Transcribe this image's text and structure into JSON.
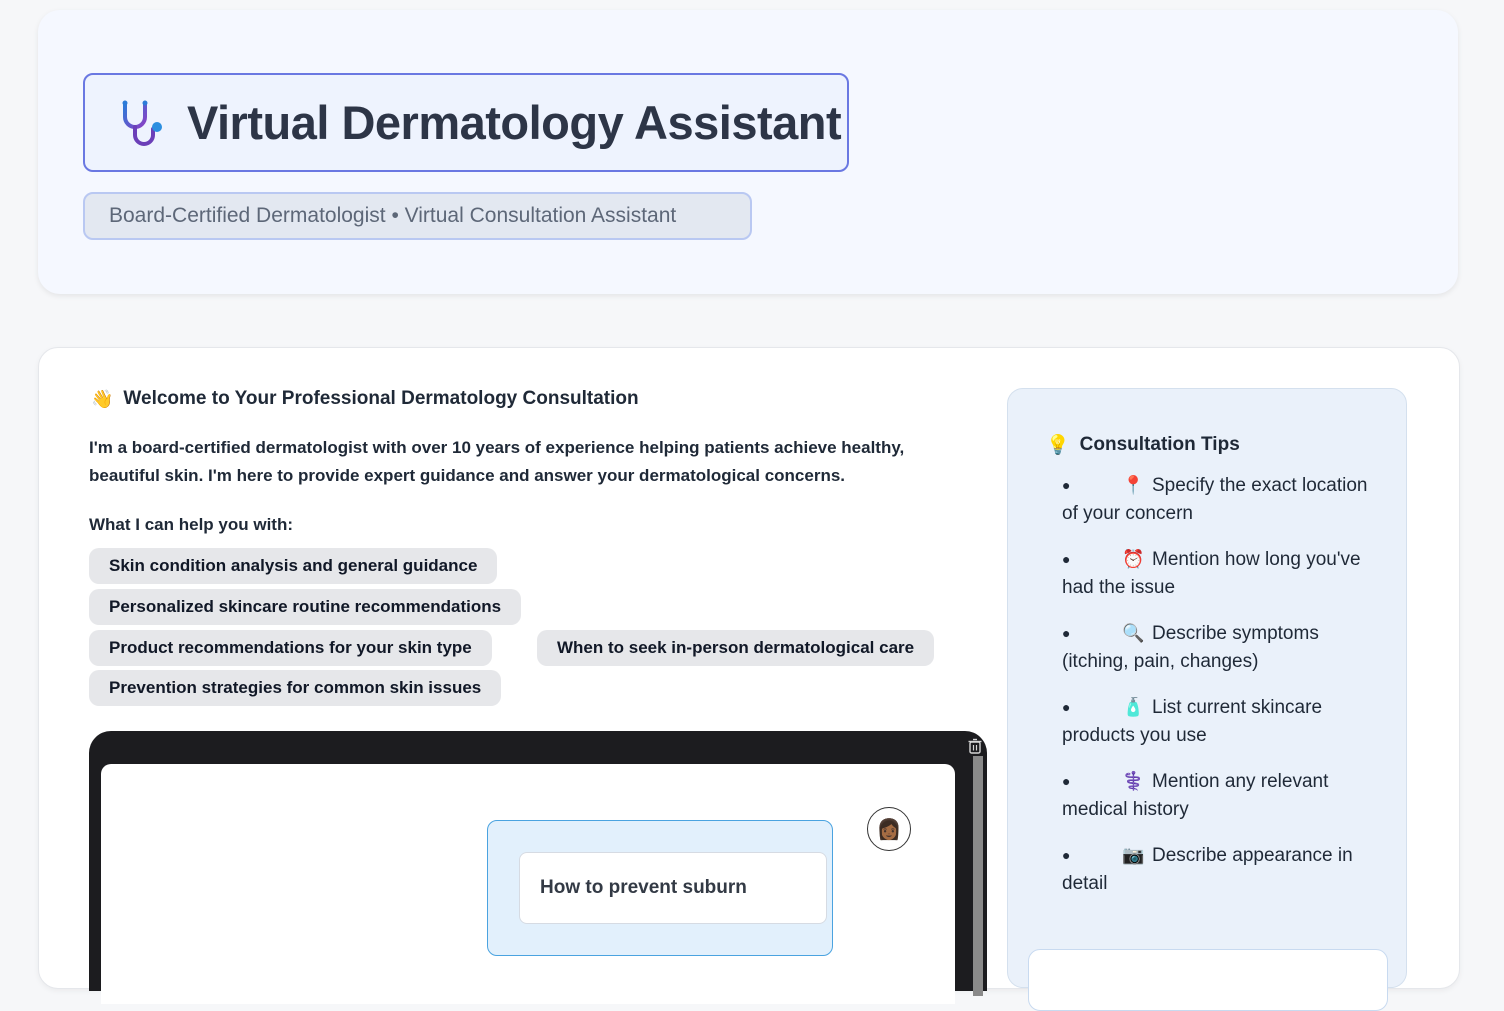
{
  "header": {
    "title": "Virtual Dermatology Assistant",
    "subtitle": "Board-Certified Dermatologist • Virtual Consultation Assistant",
    "icon": "stethoscope-icon"
  },
  "welcome": {
    "emoji": "👋",
    "title": "Welcome to Your Professional Dermatology Consultation",
    "intro": "I'm a board-certified dermatologist with over 10 years of experience helping patients achieve healthy, beautiful skin. I'm here to provide expert guidance and answer your dermatological concerns.",
    "help_label": "What I can help you with:",
    "services": [
      "Skin condition analysis and general guidance",
      "Personalized skincare routine recommendations",
      "Product recommendations for your skin type",
      "When to seek in-person dermatological care",
      "Prevention strategies for common skin issues"
    ]
  },
  "chat": {
    "messages": [
      {
        "role": "user",
        "text": "How to prevent suburn",
        "avatar": "👩🏾"
      }
    ],
    "clear_icon": "trash-icon"
  },
  "tips": {
    "emoji": "💡",
    "title": "Consultation Tips",
    "items": [
      {
        "icon": "📍",
        "text": "Specify the exact location of your concern"
      },
      {
        "icon": "⏰",
        "text": "Mention how long you've had the issue"
      },
      {
        "icon": "🔍",
        "text": "Describe symptoms (itching, pain, changes)"
      },
      {
        "icon": "🧴",
        "text": "List current skincare products you use"
      },
      {
        "icon": "⚕️",
        "text": "Mention any relevant medical history"
      },
      {
        "icon": "📷",
        "text": "Describe appearance in detail"
      }
    ]
  },
  "colors": {
    "title_border": "#6a78e2",
    "subtitle_border": "#b9c8f2",
    "chat_frame": "#1c1c1f",
    "message_bubble": "#e2f0fc",
    "message_border": "#4aa3e0",
    "tips_bg": "#eaf1fa"
  }
}
